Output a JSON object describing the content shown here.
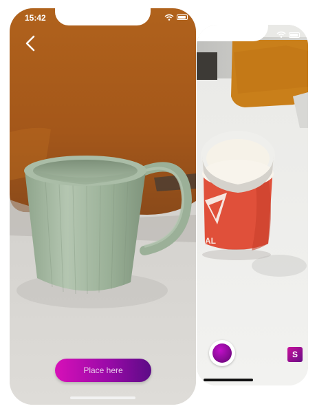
{
  "front_screen": {
    "status_bar": {
      "time": "15:42",
      "wifi_icon": "wifi-icon",
      "battery_icon": "battery-icon"
    },
    "back_icon": "chevron-left-icon",
    "place_button_label": "Place here",
    "scene": "ar-camera-view-with-3d-mug"
  },
  "back_screen": {
    "status_bar": {
      "wifi_icon": "wifi-icon",
      "battery_icon": "battery-icon"
    },
    "shutter_icon": "capture-button",
    "app_icon": "app-icon",
    "scene": "camera-view-with-placed-mug"
  },
  "colors": {
    "accent_start": "#d710b8",
    "accent_end": "#5c0b86",
    "mug_green": "#9fb39c",
    "mug_red": "#e0503a"
  }
}
